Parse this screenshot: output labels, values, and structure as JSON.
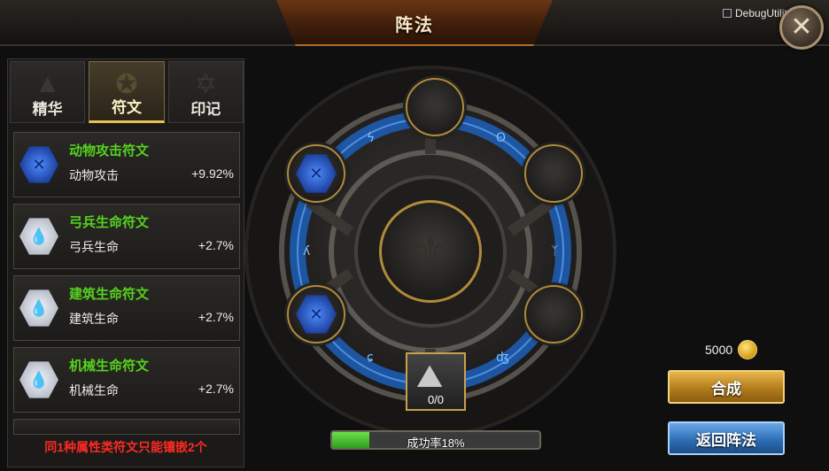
{
  "header": {
    "title": "阵法",
    "debug_label": "DebugUtility",
    "close_glyph": "✕"
  },
  "tabs": [
    {
      "label": "精华",
      "icon": "triangle-emblem-icon",
      "glyph": "▲",
      "active": false
    },
    {
      "label": "符文",
      "icon": "rune-seal-icon",
      "glyph": "✪",
      "active": true
    },
    {
      "label": "印记",
      "icon": "star-mark-icon",
      "glyph": "✡",
      "active": false
    }
  ],
  "runes": [
    {
      "name": "动物攻击符文",
      "stat": "动物攻击",
      "value": "+9.92%",
      "gem": "blue",
      "glyph": "✕"
    },
    {
      "name": "弓兵生命符文",
      "stat": "弓兵生命",
      "value": "+2.7%",
      "gem": "silver",
      "glyph": "💧"
    },
    {
      "name": "建筑生命符文",
      "stat": "建筑生命",
      "value": "+2.7%",
      "gem": "silver",
      "glyph": "💧"
    },
    {
      "name": "机械生命符文",
      "stat": "机械生命",
      "value": "+2.7%",
      "gem": "silver",
      "glyph": "💧"
    }
  ],
  "left_note": "同1种属性类符文只能镶嵌2个",
  "formation": {
    "slots": [
      {
        "id": "top",
        "filled": false
      },
      {
        "id": "upper-left",
        "filled": true,
        "glyph": "✕"
      },
      {
        "id": "upper-right",
        "filled": false
      },
      {
        "id": "lower-left",
        "filled": true,
        "glyph": "✕"
      },
      {
        "id": "lower-right",
        "filled": false
      }
    ],
    "emblem_glyph": "⚜",
    "material_glyph": "⛰",
    "material_count": "0/0",
    "success_label": "成功率18%",
    "success_rate": 0.18
  },
  "resources": {
    "gold": "5000"
  },
  "buttons": {
    "craft": "合成",
    "back": "返回阵法"
  },
  "colors": {
    "rune_name": "#55d21e",
    "warning": "#ff2a22",
    "ring_glow": "#2f7fe0",
    "frame_gold": "#b08a3a"
  }
}
